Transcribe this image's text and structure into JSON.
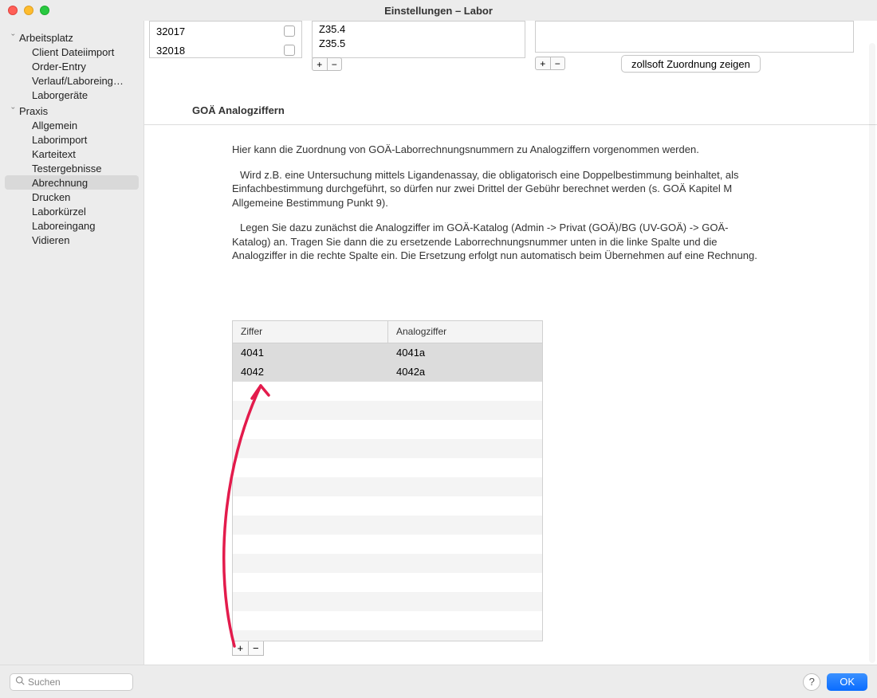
{
  "window": {
    "title": "Einstellungen – Labor"
  },
  "sidebar": {
    "groups": [
      {
        "label": "Arbeitsplatz",
        "items": [
          {
            "label": "Client Dateiimport"
          },
          {
            "label": "Order-Entry"
          },
          {
            "label": "Verlauf/Laboreing…"
          },
          {
            "label": "Laborgeräte"
          }
        ]
      },
      {
        "label": "Praxis",
        "items": [
          {
            "label": "Allgemein"
          },
          {
            "label": "Laborimport"
          },
          {
            "label": "Karteitext"
          },
          {
            "label": "Testergebnisse"
          },
          {
            "label": "Abrechnung",
            "selected": true
          },
          {
            "label": "Drucken"
          },
          {
            "label": "Laborkürzel"
          },
          {
            "label": "Laboreingang"
          },
          {
            "label": "Vidieren"
          }
        ]
      }
    ]
  },
  "top": {
    "list1": [
      {
        "code": "32017"
      },
      {
        "code": "32018"
      }
    ],
    "list2": [
      {
        "code": "Z35.4"
      },
      {
        "code": "Z35.5"
      }
    ],
    "zollsoft_btn": "zollsoft Zuordnung zeigen",
    "plus": "+",
    "minus": "−"
  },
  "section": {
    "title": "GOÄ Analogziffern",
    "p1": "Hier kann die Zuordnung von GOÄ-Laborrechnungsnummern zu Analogziffern vorgenommen werden.",
    "p2a": "Wird z.B. eine Untersuchung mittels Ligandenassay, die obligatorisch eine Doppelbestimmung beinhaltet, als Einfachbestimmung durchgeführt, so dürfen nur zwei Drittel der Gebühr berechnet werden (s. GOÄ Kapitel M Allgemeine Bestimmung Punkt 9).",
    "p3a": "Legen Sie dazu zunächst die Analogziffer im GOÄ-Katalog (Admin -> Privat (GOÄ)/BG (UV-GOÄ) -> GOÄ-Katalog) an. Tragen Sie dann die zu ersetzende Laborrechnungsnummer unten in die linke Spalte und die Analogziffer in die rechte Spalte ein. Die Ersetzung erfolgt nun automatisch beim Übernehmen auf eine Rechnung."
  },
  "table": {
    "col1": "Ziffer",
    "col2": "Analogziffer",
    "rows": [
      {
        "ziffer": "4041",
        "analog": "4041a"
      },
      {
        "ziffer": "4042",
        "analog": "4042a"
      }
    ],
    "plus": "+",
    "minus": "−"
  },
  "bottom": {
    "search_placeholder": "Suchen",
    "help": "?",
    "ok": "OK"
  }
}
